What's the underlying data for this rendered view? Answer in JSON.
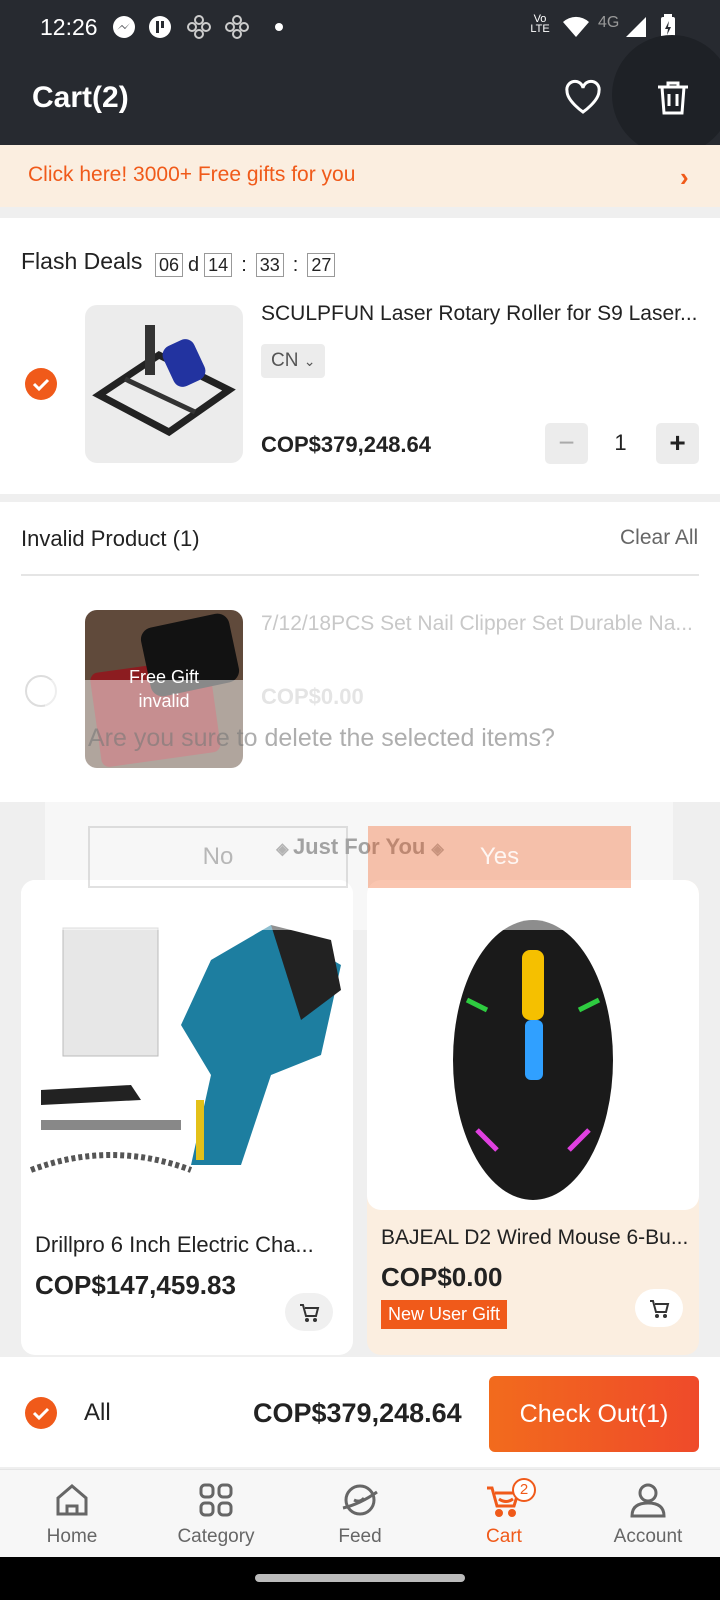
{
  "status_bar": {
    "time": "12:26",
    "network": "4G",
    "volte": "Vo LTE"
  },
  "header": {
    "title": "Cart(2)"
  },
  "banner": {
    "text": "Click here! 3000+ Free gifts for you"
  },
  "flash_deals": {
    "title": "Flash Deals",
    "countdown": {
      "days": "06",
      "d_label": "d",
      "hours": "14",
      "minutes": "33",
      "seconds": "27",
      "sep": ":"
    },
    "item": {
      "name": "SCULPFUN Laser Rotary Roller for S9 Laser...",
      "variant": "CN",
      "price": "COP$379,248.64",
      "quantity": "1",
      "minus": "−",
      "plus": "+"
    }
  },
  "invalid": {
    "title": "Invalid Product (1)",
    "clear_all": "Clear All",
    "item": {
      "name": "7/12/18PCS Set Nail Clipper Set Durable Na...",
      "overlay": "Free Gift invalid",
      "price": "COP$0.00"
    }
  },
  "dialog": {
    "message": "Are you sure to delete the selected items?",
    "no": "No",
    "yes": "Yes"
  },
  "just_for_you": {
    "title": "Just For You"
  },
  "products": [
    {
      "name": "Drillpro 6 Inch Electric Cha...",
      "price": "COP$147,459.83"
    },
    {
      "name": "BAJEAL D2 Wired Mouse 6-Bu...",
      "price": "COP$0.00",
      "badge": "New User Gift"
    }
  ],
  "bottom_bar": {
    "all_label": "All",
    "total": "COP$379,248.64",
    "checkout": "Check Out(1)"
  },
  "nav": {
    "items": [
      {
        "label": "Home",
        "icon": "home-icon"
      },
      {
        "label": "Category",
        "icon": "category-icon"
      },
      {
        "label": "Feed",
        "icon": "feed-icon"
      },
      {
        "label": "Cart",
        "icon": "cart-icon",
        "badge": "2"
      },
      {
        "label": "Account",
        "icon": "account-icon"
      }
    ]
  },
  "colors": {
    "accent": "#f05a1a",
    "header_bg": "#272a30",
    "banner_bg": "#fbeee0"
  }
}
